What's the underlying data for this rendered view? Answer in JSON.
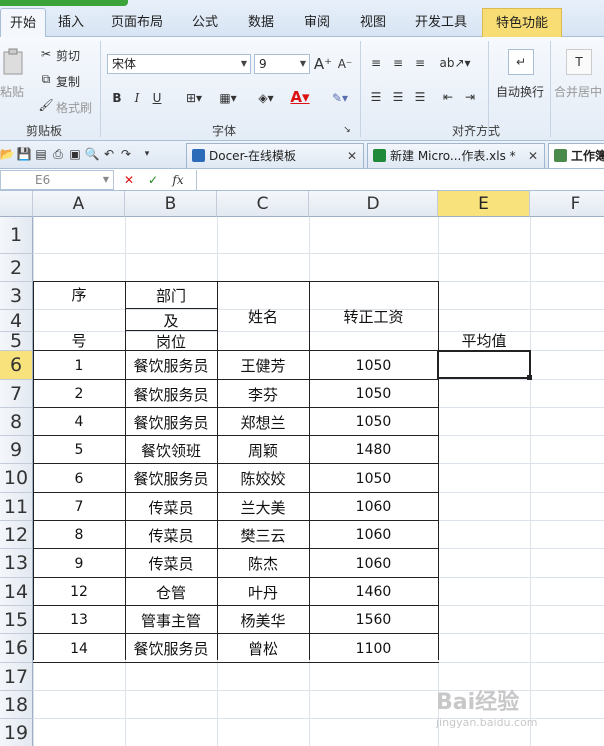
{
  "ribbon": {
    "tabs": [
      "开始",
      "插入",
      "页面布局",
      "公式",
      "数据",
      "审阅",
      "视图",
      "开发工具",
      "特色功能"
    ],
    "clipboard": {
      "paste": "粘贴",
      "cut": "剪切",
      "copy": "复制",
      "format_painter": "格式刷",
      "group": "剪贴板"
    },
    "font": {
      "name": "宋体",
      "size": "9",
      "bold": "B",
      "italic": "I",
      "underline": "U",
      "group": "字体"
    },
    "align": {
      "group": "对齐方式",
      "wrap": "自动换行",
      "merge": "合并居中"
    }
  },
  "doc_tabs": [
    "Docer-在线模板",
    "新建 Micro...作表.xls *",
    "工作簿"
  ],
  "formula_bar": {
    "name_box": "E6",
    "fx": "fx"
  },
  "columns": [
    "A",
    "B",
    "C",
    "D",
    "E",
    "F"
  ],
  "rows": [
    "1",
    "2",
    "3",
    "4",
    "5",
    "6",
    "7",
    "8",
    "9",
    "10",
    "11",
    "12",
    "13",
    "14",
    "15",
    "16",
    "17",
    "18",
    "19"
  ],
  "headers": {
    "seq_top": "序",
    "seq_bottom": "号",
    "dept1": "部门",
    "dept2": "及",
    "dept3": "岗位",
    "name": "姓名",
    "salary": "转正工资",
    "avg": "平均值"
  },
  "records": [
    {
      "seq": "1",
      "post": "餐饮服务员",
      "name": "王健芳",
      "salary": "1050"
    },
    {
      "seq": "2",
      "post": "餐饮服务员",
      "name": "李芬",
      "salary": "1050"
    },
    {
      "seq": "4",
      "post": "餐饮服务员",
      "name": "郑想兰",
      "salary": "1050"
    },
    {
      "seq": "5",
      "post": "餐饮领班",
      "name": "周颖",
      "salary": "1480"
    },
    {
      "seq": "6",
      "post": "餐饮服务员",
      "name": "陈姣姣",
      "salary": "1050"
    },
    {
      "seq": "7",
      "post": "传菜员",
      "name": "兰大美",
      "salary": "1060"
    },
    {
      "seq": "8",
      "post": "传菜员",
      "name": "樊三云",
      "salary": "1060"
    },
    {
      "seq": "9",
      "post": "传菜员",
      "name": "陈杰",
      "salary": "1060"
    },
    {
      "seq": "12",
      "post": "仓管",
      "name": "叶丹",
      "salary": "1460"
    },
    {
      "seq": "13",
      "post": "管事主管",
      "name": "杨美华",
      "salary": "1560"
    },
    {
      "seq": "14",
      "post": "餐饮服务员",
      "name": "曾松",
      "salary": "1100"
    }
  ],
  "watermark": "Bai经验",
  "watermark_url": "jingyan.baidu.com"
}
